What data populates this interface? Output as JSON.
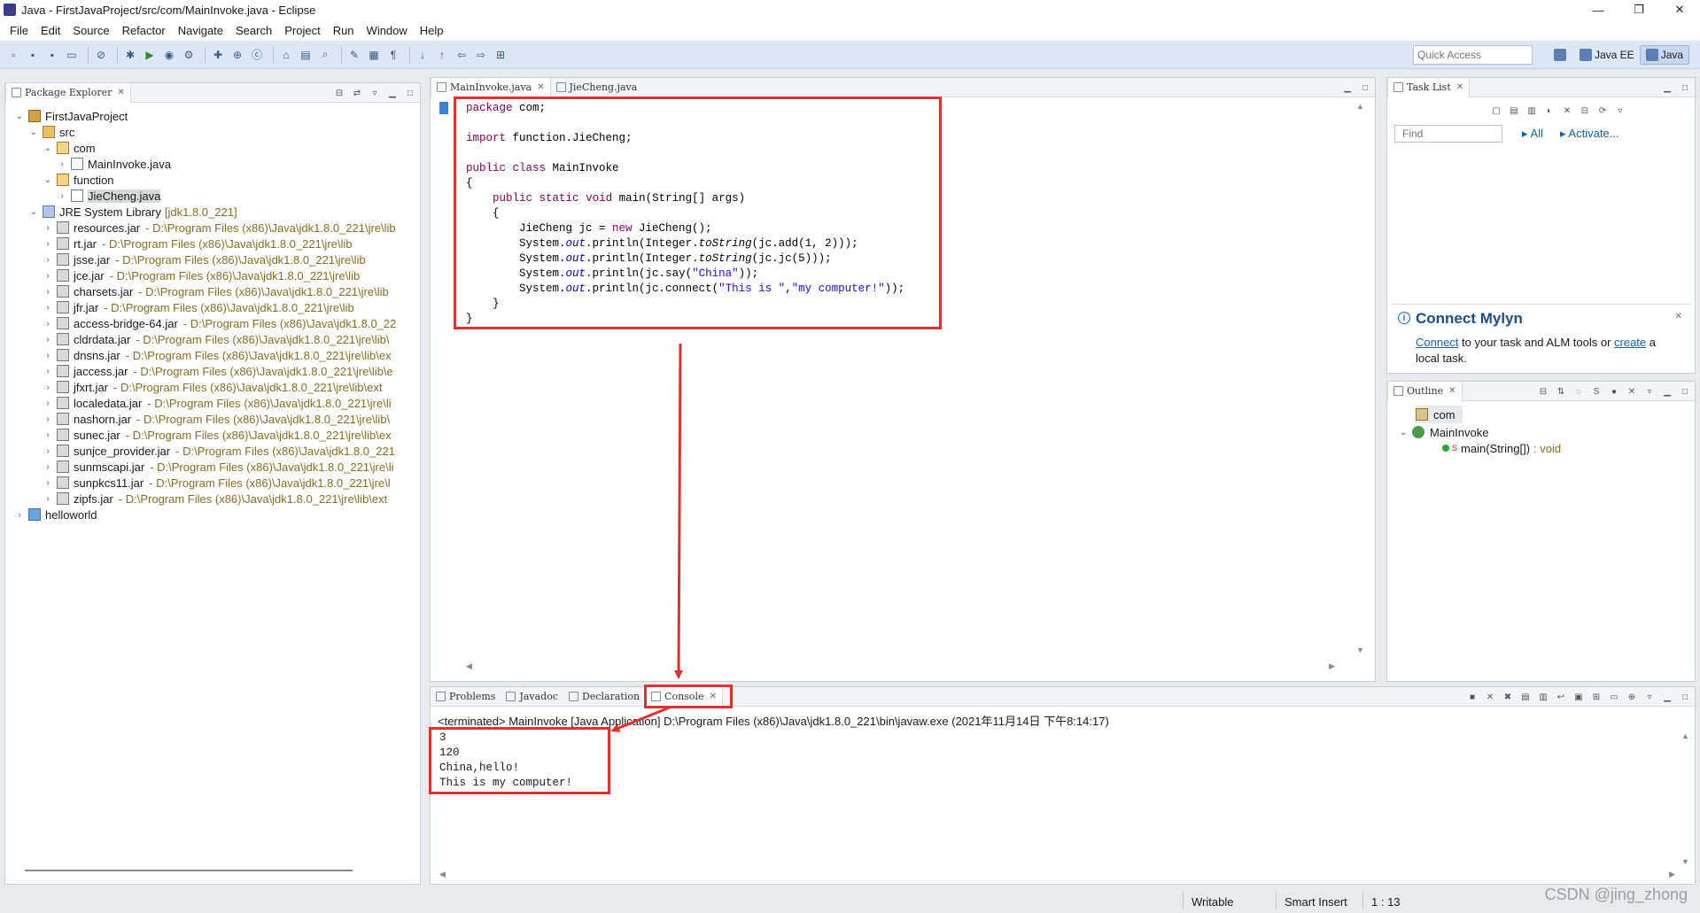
{
  "window": {
    "title": "Java - FirstJavaProject/src/com/MainInvoke.java - Eclipse",
    "controls": [
      "—",
      "❐",
      "✕"
    ]
  },
  "menu": [
    "File",
    "Edit",
    "Source",
    "Refactor",
    "Navigate",
    "Search",
    "Project",
    "Run",
    "Window",
    "Help"
  ],
  "toolbar": {
    "quick_access_placeholder": "Quick Access",
    "perspectives": [
      {
        "label": "Java EE",
        "active": false
      },
      {
        "label": "Java",
        "active": true
      }
    ]
  },
  "package_explorer": {
    "tab_label": "Package Explorer",
    "tree": [
      {
        "label": "FirstJavaProject",
        "level": 0,
        "expanded": true,
        "icon": "project-icon"
      },
      {
        "label": "src",
        "level": 1,
        "expanded": true,
        "icon": "source-folder-icon"
      },
      {
        "label": "com",
        "level": 2,
        "expanded": true,
        "icon": "package-icon"
      },
      {
        "label": "MainInvoke.java",
        "level": 3,
        "expanded": false,
        "icon": "java-file-icon"
      },
      {
        "label": "function",
        "level": 2,
        "expanded": true,
        "icon": "package-icon"
      },
      {
        "label": "JieCheng.java",
        "level": 3,
        "expanded": false,
        "icon": "java-file-icon",
        "selected": true
      },
      {
        "label": "JRE System Library",
        "decoration": "[jdk1.8.0_221]",
        "level": 1,
        "expanded": true,
        "icon": "library-icon"
      },
      {
        "label": "resources.jar",
        "path": "D:\\Program Files (x86)\\Java\\jdk1.8.0_221\\jre\\lib",
        "level": 2,
        "icon": "jar-icon"
      },
      {
        "label": "rt.jar",
        "path": "D:\\Program Files (x86)\\Java\\jdk1.8.0_221\\jre\\lib",
        "level": 2,
        "icon": "jar-icon"
      },
      {
        "label": "jsse.jar",
        "path": "D:\\Program Files (x86)\\Java\\jdk1.8.0_221\\jre\\lib",
        "level": 2,
        "icon": "jar-icon"
      },
      {
        "label": "jce.jar",
        "path": "D:\\Program Files (x86)\\Java\\jdk1.8.0_221\\jre\\lib",
        "level": 2,
        "icon": "jar-icon"
      },
      {
        "label": "charsets.jar",
        "path": "D:\\Program Files (x86)\\Java\\jdk1.8.0_221\\jre\\lib",
        "level": 2,
        "icon": "jar-icon"
      },
      {
        "label": "jfr.jar",
        "path": "D:\\Program Files (x86)\\Java\\jdk1.8.0_221\\jre\\lib",
        "level": 2,
        "icon": "jar-icon"
      },
      {
        "label": "access-bridge-64.jar",
        "path": "D:\\Program Files (x86)\\Java\\jdk1.8.0_22",
        "level": 2,
        "icon": "jar-icon"
      },
      {
        "label": "cldrdata.jar",
        "path": "D:\\Program Files (x86)\\Java\\jdk1.8.0_221\\jre\\lib\\",
        "level": 2,
        "icon": "jar-icon"
      },
      {
        "label": "dnsns.jar",
        "path": "D:\\Program Files (x86)\\Java\\jdk1.8.0_221\\jre\\lib\\ex",
        "level": 2,
        "icon": "jar-icon"
      },
      {
        "label": "jaccess.jar",
        "path": "D:\\Program Files (x86)\\Java\\jdk1.8.0_221\\jre\\lib\\e",
        "level": 2,
        "icon": "jar-icon"
      },
      {
        "label": "jfxrt.jar",
        "path": "D:\\Program Files (x86)\\Java\\jdk1.8.0_221\\jre\\lib\\ext",
        "level": 2,
        "icon": "jar-icon"
      },
      {
        "label": "localedata.jar",
        "path": "D:\\Program Files (x86)\\Java\\jdk1.8.0_221\\jre\\li",
        "level": 2,
        "icon": "jar-icon"
      },
      {
        "label": "nashorn.jar",
        "path": "D:\\Program Files (x86)\\Java\\jdk1.8.0_221\\jre\\lib\\",
        "level": 2,
        "icon": "jar-icon"
      },
      {
        "label": "sunec.jar",
        "path": "D:\\Program Files (x86)\\Java\\jdk1.8.0_221\\jre\\lib\\ex",
        "level": 2,
        "icon": "jar-icon"
      },
      {
        "label": "sunjce_provider.jar",
        "path": "D:\\Program Files (x86)\\Java\\jdk1.8.0_221",
        "level": 2,
        "icon": "jar-icon"
      },
      {
        "label": "sunmscapi.jar",
        "path": "D:\\Program Files (x86)\\Java\\jdk1.8.0_221\\jre\\li",
        "level": 2,
        "icon": "jar-icon"
      },
      {
        "label": "sunpkcs11.jar",
        "path": "D:\\Program Files (x86)\\Java\\jdk1.8.0_221\\jre\\l",
        "level": 2,
        "icon": "jar-icon"
      },
      {
        "label": "zipfs.jar",
        "path": "D:\\Program Files (x86)\\Java\\jdk1.8.0_221\\jre\\lib\\ext",
        "level": 2,
        "icon": "jar-icon"
      },
      {
        "label": "helloworld",
        "level": 0,
        "expanded": false,
        "icon": "project-icon"
      }
    ]
  },
  "editor": {
    "tabs": [
      {
        "label": "MainInvoke.java",
        "active": true
      },
      {
        "label": "JieCheng.java",
        "active": false
      }
    ],
    "lines": [
      [
        {
          "t": "package",
          "c": "kw"
        },
        {
          "t": " com;"
        }
      ],
      [],
      [
        {
          "t": "import",
          "c": "kw"
        },
        {
          "t": " function.JieCheng;"
        }
      ],
      [],
      [
        {
          "t": "public",
          "c": "kw"
        },
        {
          "t": " "
        },
        {
          "t": "class",
          "c": "kw"
        },
        {
          "t": " MainInvoke"
        }
      ],
      [
        {
          "t": "{"
        }
      ],
      [
        {
          "t": "    "
        },
        {
          "t": "public",
          "c": "kw"
        },
        {
          "t": " "
        },
        {
          "t": "static",
          "c": "kw"
        },
        {
          "t": " "
        },
        {
          "t": "void",
          "c": "kw"
        },
        {
          "t": " main(String[] args)"
        }
      ],
      [
        {
          "t": "    {"
        }
      ],
      [
        {
          "t": "        JieCheng jc = "
        },
        {
          "t": "new",
          "c": "kw"
        },
        {
          "t": " JieCheng();"
        }
      ],
      [
        {
          "t": "        System."
        },
        {
          "t": "out",
          "c": "fld it"
        },
        {
          "t": ".println(Integer."
        },
        {
          "t": "toString",
          "c": "it"
        },
        {
          "t": "(jc.add(1, 2)));"
        }
      ],
      [
        {
          "t": "        System."
        },
        {
          "t": "out",
          "c": "fld it"
        },
        {
          "t": ".println(Integer."
        },
        {
          "t": "toString",
          "c": "it"
        },
        {
          "t": "(jc.jc(5)));"
        }
      ],
      [
        {
          "t": "        System."
        },
        {
          "t": "out",
          "c": "fld it"
        },
        {
          "t": ".println(jc.say("
        },
        {
          "t": "\"China\"",
          "c": "str"
        },
        {
          "t": "));"
        }
      ],
      [
        {
          "t": "        System."
        },
        {
          "t": "out",
          "c": "fld it"
        },
        {
          "t": ".println(jc.connect("
        },
        {
          "t": "\"This is \"",
          "c": "str"
        },
        {
          "t": ","
        },
        {
          "t": "\"my computer!\"",
          "c": "str"
        },
        {
          "t": "));"
        }
      ],
      [
        {
          "t": "    }"
        }
      ],
      [
        {
          "t": "}"
        }
      ]
    ]
  },
  "task_list": {
    "tab_label": "Task List",
    "find_placeholder": "Find",
    "all_label": "All",
    "activate_label": "Activate...",
    "mylyn": {
      "title": "Connect Mylyn",
      "text_connect": "Connect",
      "text_middle": " to your task and ALM tools or ",
      "text_create": "create",
      "text_end": " a local task."
    }
  },
  "outline": {
    "tab_label": "Outline",
    "items": [
      {
        "label": "com",
        "icon": "import-declarations-icon"
      },
      {
        "label": "MainInvoke",
        "icon": "class-icon",
        "expanded": true
      },
      {
        "label": "main(String[])",
        "type": ": void",
        "modifier": "S",
        "icon": "public-method-icon"
      }
    ]
  },
  "console": {
    "tabs": [
      {
        "label": "Problems",
        "active": false
      },
      {
        "label": "Javadoc",
        "active": false
      },
      {
        "label": "Declaration",
        "active": false
      },
      {
        "label": "Console",
        "active": true
      }
    ],
    "terminated": "<terminated> MainInvoke [Java Application] D:\\Program Files (x86)\\Java\\jdk1.8.0_221\\bin\\javaw.exe (2021年11月14日 下午8:14:17)",
    "output": [
      "3",
      "120",
      "China,hello!",
      "This is my computer!"
    ]
  },
  "status_bar": {
    "writable": "Writable",
    "insert_mode": "Smart Insert",
    "position": "1 : 13"
  },
  "watermark": "CSDN @jing_zhong",
  "annotation_color": "#e03131"
}
